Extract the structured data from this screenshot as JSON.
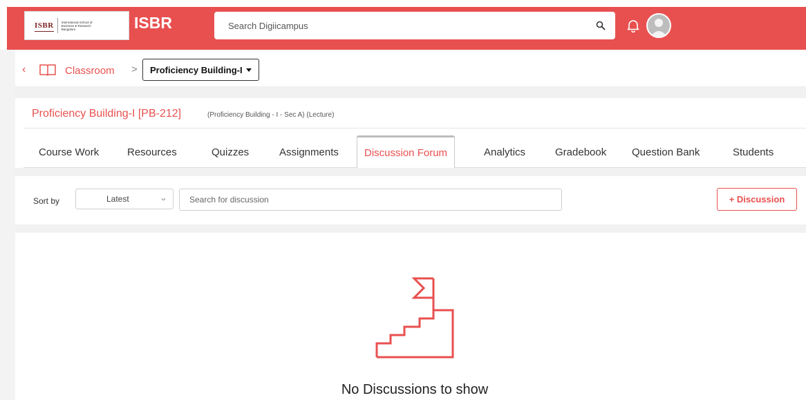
{
  "header": {
    "logo_mark": "ISBR",
    "logo_text": "International School of Business & Research Bangalore",
    "brand": "ISBR",
    "search_placeholder": "Search Digiicampus",
    "accent_color": "#e8504f"
  },
  "breadcrumb": {
    "link_label": "Classroom",
    "separator": ">",
    "current_course": "Proficiency Building-I"
  },
  "course": {
    "title": "Proficiency Building-I [PB-212]",
    "meta": "(Proficiency Building - I - Sec A)  (Lecture)"
  },
  "tabs": [
    {
      "label": "Course Work"
    },
    {
      "label": "Resources"
    },
    {
      "label": "Quizzes"
    },
    {
      "label": "Assignments"
    },
    {
      "label": "Discussion Forum",
      "active": true
    },
    {
      "label": "Analytics"
    },
    {
      "label": "Gradebook"
    },
    {
      "label": "Question Bank"
    },
    {
      "label": "Students"
    }
  ],
  "toolbar": {
    "sort_label": "Sort by",
    "sort_value": "Latest",
    "search_placeholder": "Search for discussion",
    "add_label": "+ Discussion"
  },
  "empty_state": {
    "message": "No Discussions to show",
    "icon": "stairs-flag-icon"
  }
}
